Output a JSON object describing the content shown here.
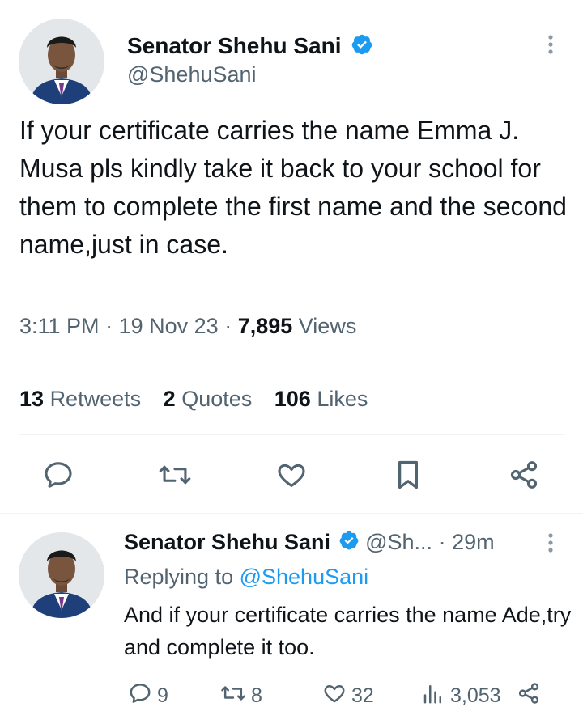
{
  "main_tweet": {
    "author_name": "Senator Shehu Sani",
    "author_handle": "@ShehuSani",
    "text": "If your certificate carries the name Emma J. Musa pls kindly take it back to your school for them to complete the first name and the second name,just in case.",
    "time": "3:11 PM",
    "date": "19 Nov 23",
    "views_count": "7,895",
    "views_label": "Views",
    "retweets_count": "13",
    "retweets_label": "Retweets",
    "quotes_count": "2",
    "quotes_label": "Quotes",
    "likes_count": "106",
    "likes_label": "Likes",
    "actions": [
      "reply-icon",
      "retweet-icon",
      "like-icon",
      "bookmark-icon",
      "share-icon"
    ]
  },
  "reply_tweet": {
    "author_name": "Senator Shehu Sani",
    "author_handle": "@Sh...",
    "age": "29m",
    "replying_to_label": "Replying to",
    "replying_to_handle": "@ShehuSani",
    "text": "And if your certificate carries the name Ade,try and complete it too.",
    "replies": "9",
    "retweets": "8",
    "likes": "32",
    "views": "3,053"
  },
  "colors": {
    "verified": "#1d9bf0",
    "secondary_text": "#536471",
    "link": "#1d9bf0"
  }
}
